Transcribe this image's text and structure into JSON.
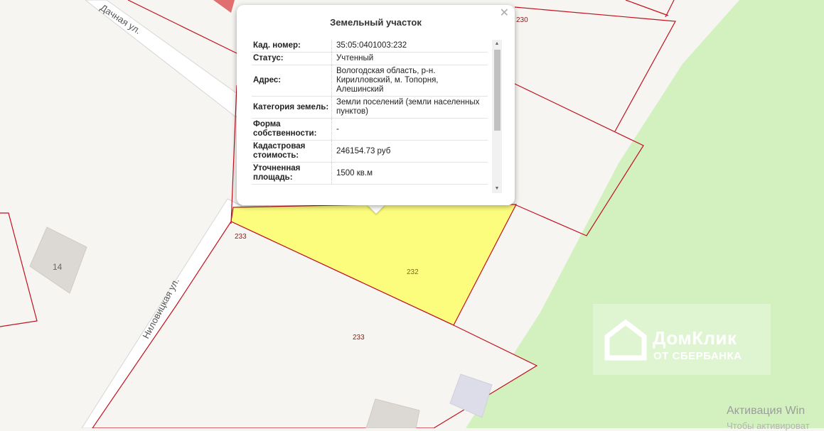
{
  "map": {
    "streets": [
      "Дачная ул.",
      "Ниловицкая ул."
    ],
    "parcel_labels": [
      "233",
      "233",
      "232",
      "230"
    ],
    "building_number": "14",
    "colors": {
      "boundary": "#c1121f",
      "selected_parcel": "#fdfd7d",
      "forest": "#d3f1bf",
      "ground": "#f6f5f1",
      "road": "#ffffff"
    }
  },
  "popup": {
    "title": "Земельный участок",
    "close_icon": "close-icon",
    "rows": [
      {
        "key": "Кад. номер:",
        "value": "35:05:0401003:232"
      },
      {
        "key": "Статус:",
        "value": "Учтенный"
      },
      {
        "key": "Адрес:",
        "value": "Вологодская область, р-н. Кирилловский, м. Топорня, Алешинский"
      },
      {
        "key": "Категория земель:",
        "value": "Земли поселений (земли населенных пунктов)"
      },
      {
        "key": "Форма собственности:",
        "value": "-"
      },
      {
        "key": "Кадастровая стоимость:",
        "value": "246154.73 руб"
      },
      {
        "key": "Уточненная площадь:",
        "value": "1500 кв.м"
      }
    ],
    "scroll_position": 0
  },
  "watermark": {
    "name": "ДомКлик",
    "sub": "ОТ СБЕРБАНКА"
  },
  "activation_notice": {
    "line1": "Активация Win",
    "line2": "Чтобы активироват"
  }
}
